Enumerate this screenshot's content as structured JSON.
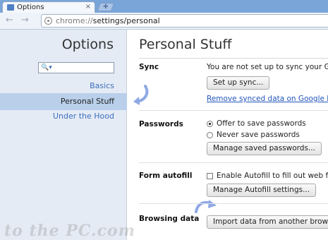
{
  "tab": {
    "title": "Options",
    "close": "×"
  },
  "toolbar": {
    "back": "←",
    "forward": "→",
    "url_scheme": "chrome://",
    "url_path": "settings/personal"
  },
  "sidebar": {
    "title": "Options",
    "search_icon": "🔍▾",
    "items": [
      {
        "label": "Basics"
      },
      {
        "label": "Personal Stuff",
        "selected": true
      },
      {
        "label": "Under the Hood"
      }
    ]
  },
  "main": {
    "title": "Personal Stuff",
    "sync": {
      "label": "Sync",
      "status": "You are not set up to sync your Google Chrome data",
      "setup_button": "Set up sync...",
      "remove_link": "Remove synced data on Google Dashboard"
    },
    "passwords": {
      "label": "Passwords",
      "offer": "Offer to save passwords",
      "never": "Never save passwords",
      "manage_button": "Manage saved passwords..."
    },
    "autofill": {
      "label": "Form autofill",
      "enable": "Enable Autofill to fill out web forms in a single click",
      "manage_button": "Manage Autofill settings..."
    },
    "browsing": {
      "label": "Browsing data",
      "import_button": "Import data from another browser..."
    }
  },
  "watermark": "to the PC.com",
  "colors": {
    "accent": "#3d6ebc",
    "sidebar_bg": "#e4ebf5",
    "selected_bg": "#b9cfea",
    "arrow": "#8fa8e6"
  }
}
